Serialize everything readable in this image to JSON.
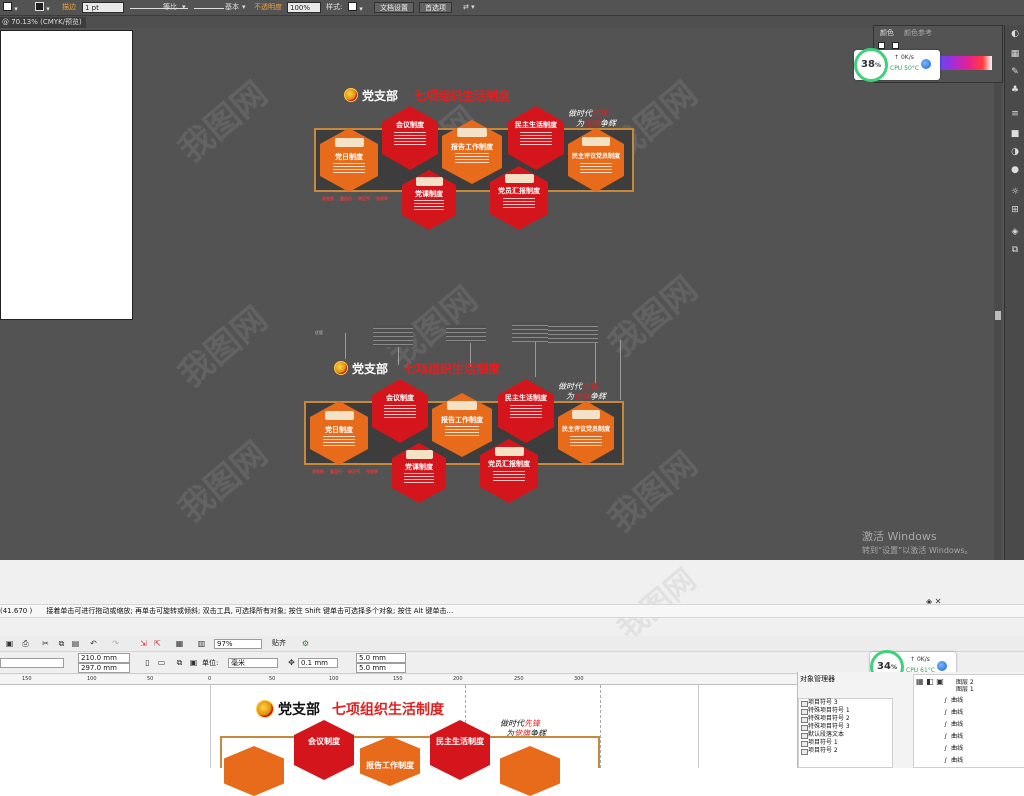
{
  "illustrator": {
    "control_bar": {
      "stroke_label": "描边",
      "stroke_weight": "1 pt",
      "profile_uniform": "等比",
      "brush_basic": "基本",
      "opacity_label": "不透明度",
      "opacity_value": "100%",
      "style_label": "样式:",
      "doc_setup_button": "文档设置",
      "preferences_button": "首选项"
    },
    "doc_tab": "@ 70.13% (CMYK/预览)",
    "color_panel": {
      "tab_color": "颜色",
      "tab_color_guide": "颜色参考"
    },
    "perf_widget": {
      "percent": "38",
      "speed": "0K/s",
      "cpu_label": "CPU",
      "cpu_temp": "50°C"
    },
    "activate_windows": {
      "title": "激活 Windows",
      "subtitle": "转到“设置”以激活 Windows。"
    },
    "design_top": {
      "party_label": "党支部",
      "main_title": "七项组织生活制度",
      "slogan_line1_prefix": "做时代",
      "slogan_line1_red": "先锋",
      "slogan_line2_prefix": "为",
      "slogan_line2_red": "党旗",
      "slogan_line2_suffix": "争辉",
      "hexagons": [
        "党日制度",
        "会议制度",
        "报告工作制度",
        "民主生活制度",
        "民主评议党员制度",
        "党课制度",
        "党员汇报制度"
      ],
      "tags": [
        "讲党性",
        "重品行",
        "树正气",
        "作表率"
      ]
    },
    "design_bottom": {
      "party_label": "党支部",
      "main_title": "七项组织生活制度",
      "slogan_line1_prefix": "做时代",
      "slogan_line1_red": "先锋",
      "slogan_line2_prefix": "为",
      "slogan_line2_red": "党旗",
      "slogan_line2_suffix": "争辉",
      "hexagons": [
        "党日制度",
        "会议制度",
        "报告工作制度",
        "民主生活制度",
        "民主评议党员制度",
        "党课制度",
        "党员汇报制度"
      ],
      "tags": [
        "讲党性",
        "重品行",
        "树正气",
        "作表率"
      ],
      "callout_label": "优版"
    },
    "watermark_text": "我图网"
  },
  "coreldraw": {
    "status_coords": "(41.670 )",
    "status_hint": "接着单击可进行拖动或缩放; 再单击可旋转或倾斜; 双击工具, 可选择所有对象; 按住 Shift 键单击可选择多个对象; 按住 Alt 键单击...",
    "zoom_value": "97%",
    "snap_label": "贴齐",
    "width_value": "210.0 mm",
    "height_value": "297.0 mm",
    "units_label": "单位:",
    "units_value": "毫米",
    "nudge_value": "0.1 mm",
    "dup_x_value": "5.0 mm",
    "dup_y_value": "5.0 mm",
    "ruler_numbers": [
      "150",
      "100",
      "50",
      "0",
      "50",
      "100",
      "150",
      "200",
      "250",
      "300"
    ],
    "perf_widget": {
      "percent": "34",
      "speed": "0K/s",
      "cpu_label": "CPU",
      "cpu_temp": "61°C"
    },
    "docker": {
      "title": "对象管理器",
      "list_items": [
        "项目符号 3",
        "特殊项目符号 1",
        "特殊项目符号 2",
        "特殊项目符号 3",
        "默认段落文本",
        "项目符号 1",
        "项目符号 2"
      ],
      "layer_labels": [
        "图层 2",
        "图层 1"
      ],
      "tree_items": [
        "曲线",
        "曲线",
        "曲线",
        "曲线",
        "曲线",
        "曲线"
      ]
    },
    "design_preview": {
      "party_label": "党支部",
      "main_title": "七项组织生活制度",
      "slogan_line1_prefix": "做时代",
      "slogan_line1_red": "先锋",
      "slogan_line2_prefix": "为",
      "slogan_line2_red": "党旗",
      "slogan_line2_suffix": "争辉",
      "hexagons": [
        "会议制度",
        "报告工作制度",
        "民主生活制度"
      ]
    }
  },
  "colors": {
    "party_red": "#d4161c",
    "party_orange": "#e86b1b",
    "frame_gold": "#c8883a",
    "ai_canvas": "#535353",
    "perf_green": "#3fd07a"
  }
}
